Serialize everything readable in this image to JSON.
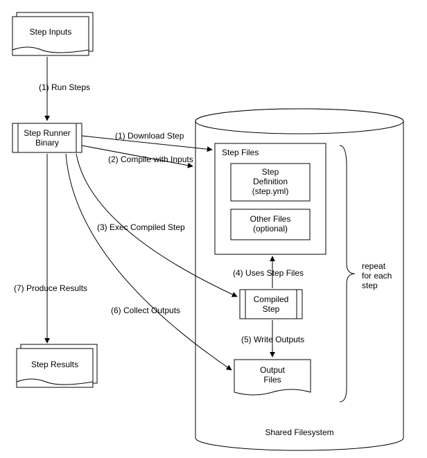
{
  "nodes": {
    "step_inputs": "Step Inputs",
    "step_runner_binary_l1": "Step Runner",
    "step_runner_binary_l2": "Binary",
    "step_results": "Step Results",
    "shared_filesystem": "Shared Filesystem",
    "step_files": "Step Files",
    "step_definition_l1": "Step",
    "step_definition_l2": "Definition",
    "step_definition_l3": "(step.yml)",
    "other_files_l1": "Other Files",
    "other_files_l2": "(optional)",
    "compiled_step_l1": "Compiled",
    "compiled_step_l2": "Step",
    "output_files_l1": "Output",
    "output_files_l2": "Files"
  },
  "edges": {
    "run_steps": "(1) Run Steps",
    "download_step": "(1) Download Step",
    "compile_with_inputs": "(2) Compile with Inputs",
    "exec_compiled_step": "(3) Exec Compiled Step",
    "uses_step_files": "(4) Uses Step Files",
    "write_outputs": "(5) Write Outputs",
    "collect_outputs": "(6) Collect Outputs",
    "produce_results": "(7) Produce Results"
  },
  "annotation": {
    "repeat_l1": "repeat",
    "repeat_l2": "for each",
    "repeat_l3": "step"
  }
}
